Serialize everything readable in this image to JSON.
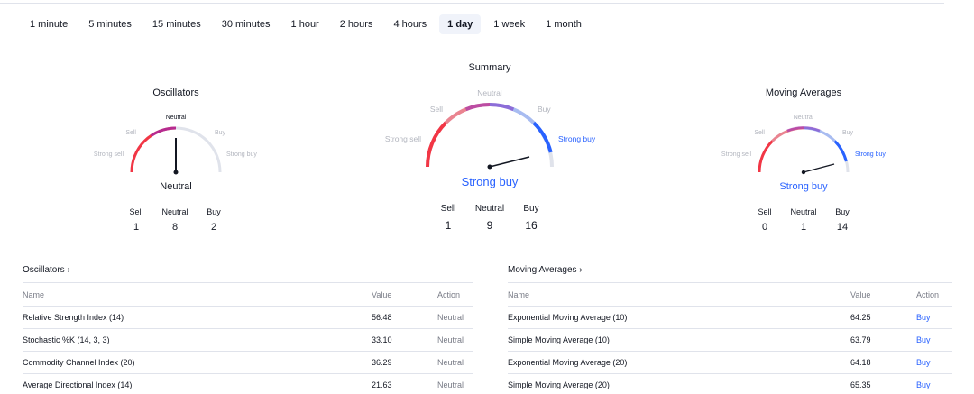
{
  "tabs": [
    {
      "label": "1 minute",
      "active": false
    },
    {
      "label": "5 minutes",
      "active": false
    },
    {
      "label": "15 minutes",
      "active": false
    },
    {
      "label": "30 minutes",
      "active": false
    },
    {
      "label": "1 hour",
      "active": false
    },
    {
      "label": "2 hours",
      "active": false
    },
    {
      "label": "4 hours",
      "active": false
    },
    {
      "label": "1 day",
      "active": true
    },
    {
      "label": "1 week",
      "active": false
    },
    {
      "label": "1 month",
      "active": false
    }
  ],
  "gauge_labels": {
    "strong_sell": "Strong sell",
    "sell": "Sell",
    "neutral": "Neutral",
    "buy": "Buy",
    "strong_buy": "Strong buy"
  },
  "count_labels": {
    "sell": "Sell",
    "neutral": "Neutral",
    "buy": "Buy"
  },
  "colors": {
    "sell": "#f23645",
    "buy": "#2962ff",
    "neutral_track": "#e0e3eb",
    "needle": "#131722"
  },
  "oscillators": {
    "title": "Oscillators",
    "verdict": "Neutral",
    "sell": "1",
    "neutral": "8",
    "buy": "2"
  },
  "summary": {
    "title": "Summary",
    "verdict": "Strong buy",
    "sell": "1",
    "neutral": "9",
    "buy": "16"
  },
  "moving_averages": {
    "title": "Moving Averages",
    "verdict": "Strong buy",
    "sell": "0",
    "neutral": "1",
    "buy": "14"
  },
  "osc_table": {
    "title": "Oscillators ›",
    "headers": {
      "name": "Name",
      "value": "Value",
      "action": "Action"
    },
    "rows": [
      {
        "name": "Relative Strength Index (14)",
        "value": "56.48",
        "action": "Neutral"
      },
      {
        "name": "Stochastic %K (14, 3, 3)",
        "value": "33.10",
        "action": "Neutral"
      },
      {
        "name": "Commodity Channel Index (20)",
        "value": "36.29",
        "action": "Neutral"
      },
      {
        "name": "Average Directional Index (14)",
        "value": "21.63",
        "action": "Neutral"
      }
    ]
  },
  "ma_table": {
    "title": "Moving Averages ›",
    "headers": {
      "name": "Name",
      "value": "Value",
      "action": "Action"
    },
    "rows": [
      {
        "name": "Exponential Moving Average (10)",
        "value": "64.25",
        "action": "Buy"
      },
      {
        "name": "Simple Moving Average (10)",
        "value": "63.79",
        "action": "Buy"
      },
      {
        "name": "Exponential Moving Average (20)",
        "value": "64.18",
        "action": "Buy"
      },
      {
        "name": "Simple Moving Average (20)",
        "value": "65.35",
        "action": "Buy"
      }
    ]
  }
}
